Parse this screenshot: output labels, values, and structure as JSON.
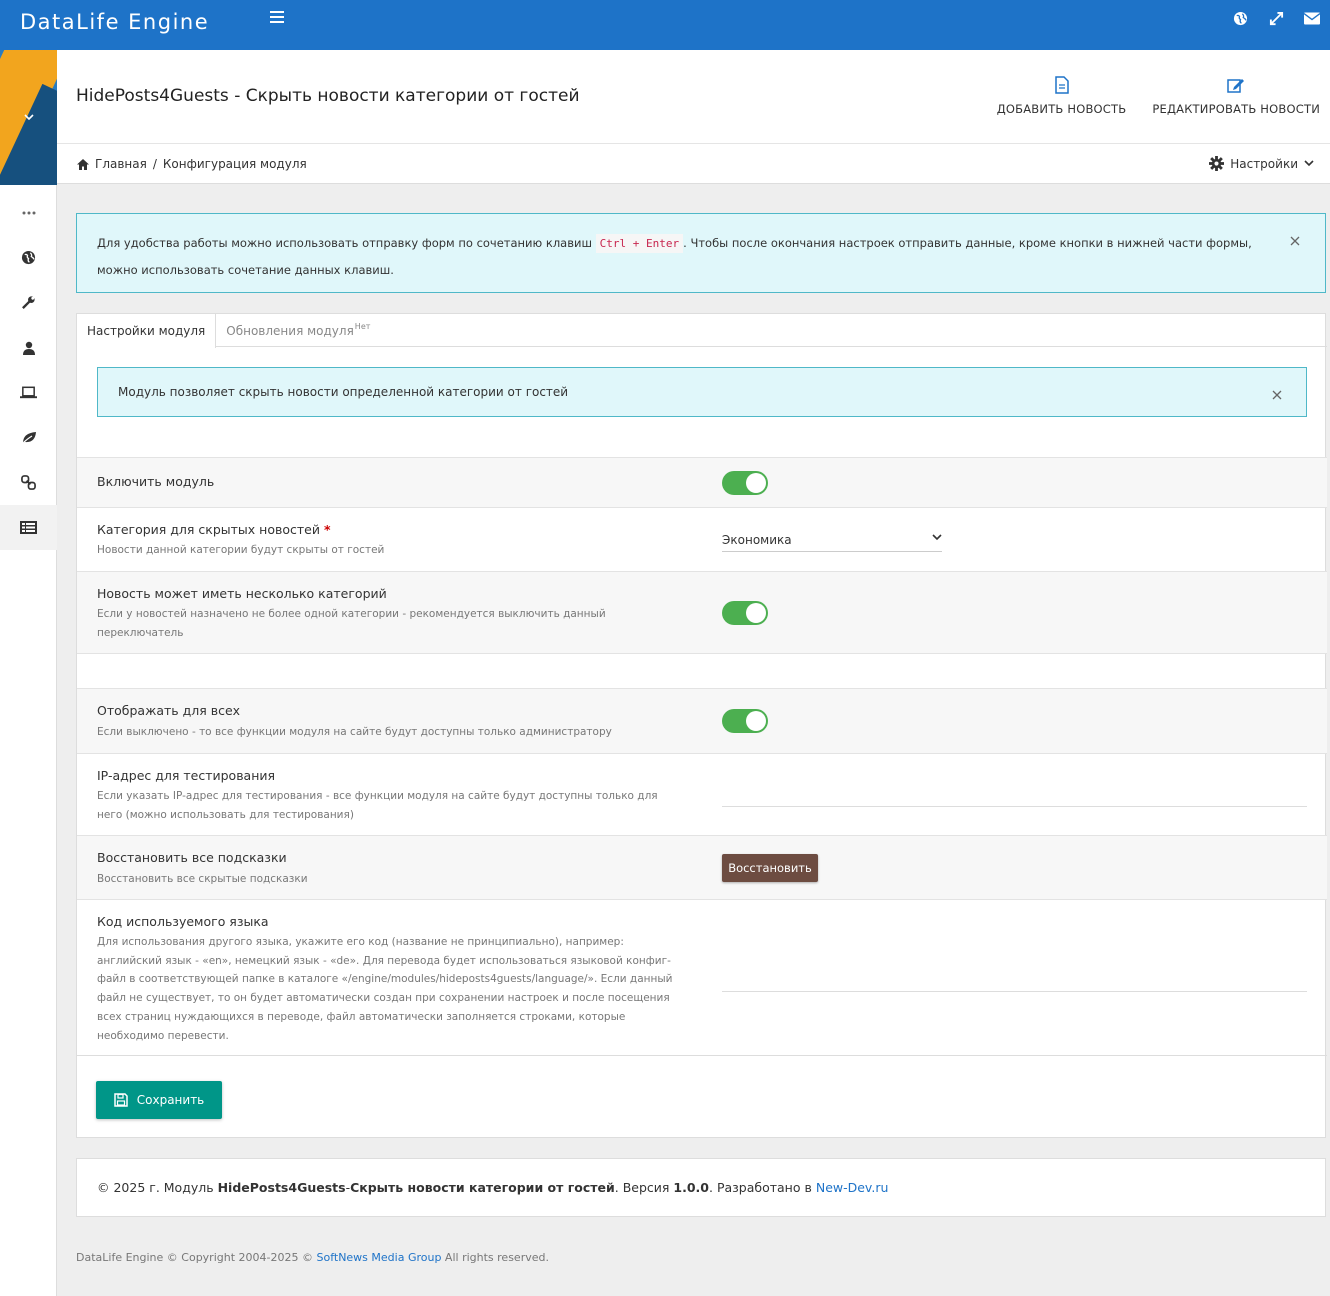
{
  "navbar": {
    "brand": "DataLife Engine",
    "icons": [
      "globe-icon",
      "expand-icon",
      "mail-icon"
    ]
  },
  "sidebar": {
    "items": [
      "dots-icon",
      "globe-icon",
      "wrench-icon",
      "user-icon",
      "laptop-icon",
      "leaf-icon",
      "link-icon",
      "list-icon"
    ],
    "active_item": "list-icon"
  },
  "header": {
    "title": "HidePosts4Guests - Скрыть новости категории от гостей",
    "add_news": "ДОБАВИТЬ НОВОСТЬ",
    "edit_news": "РЕДАКТИРОВАТЬ НОВОСТИ"
  },
  "breadcrumb": {
    "home": "Главная",
    "separator": "/",
    "current": "Конфигурация модуля",
    "settings": "Настройки"
  },
  "info_alert": {
    "text_before": "Для удобства работы можно использовать отправку форм по сочетанию клавиш",
    "shortcut": "Ctrl + Enter",
    "text_after": ". Чтобы после окончания настроек отправить данные, кроме кнопки в нижней части формы,",
    "text_line2": "можно использовать сочетание данных клавиш."
  },
  "tabs": {
    "settings": "Настройки модуля",
    "updates": "Обновления модуля",
    "updates_badge": "Нет"
  },
  "module_alert": "Модуль позволяет скрыть новости определенной категории от гостей",
  "settings": {
    "enable": {
      "label": "Включить модуль",
      "on": true
    },
    "category": {
      "label": "Категория для скрытых новостей",
      "required_mark": "*",
      "desc": "Новости данной категории будут скрыты от гостей",
      "value": "Экономика"
    },
    "multi_cat": {
      "label": "Новость может иметь несколько категорий",
      "desc": "Если у новостей назначено не более одной категории - рекомендуется выключить данный переключатель",
      "on": true
    },
    "show_all": {
      "label": "Отображать для всех",
      "desc": "Если выключено - то все функции модуля на сайте будут доступны только администратору",
      "on": true
    },
    "test_ip": {
      "label": "IP-адрес для тестирования",
      "desc": "Если указать IP-адрес для тестирования - все функции модуля на сайте будут доступны только для него (можно использовать для тестирования)",
      "value": ""
    },
    "restore_hints": {
      "label": "Восстановить все подсказки",
      "desc": "Восстановить все скрытые подсказки",
      "button": "Восстановить"
    },
    "lang_code": {
      "label": "Код используемого языка",
      "desc": "Для использования другого языка, укажите его код (название не принципиально), например: английский язык - «en», немецкий язык - «de». Для перевода будет использоваться языковой конфиг-файл в соответствующей папке в каталоге «/engine/modules/hideposts4guests/language/». Если данный файл не существует, то он будет автоматически создан при сохранении настроек и после посещения всех страниц нуждающихся в переводе, файл автоматически заполняется строками, которые необходимо перевести.",
      "value": ""
    }
  },
  "save_button": "Сохранить",
  "footer": {
    "prefix": "© 2025 г. Модуль ",
    "module_name": "HidePosts4Guests",
    "dash": " - ",
    "module_title": "Скрыть новости категории от гостей",
    "version_label": ". Версия ",
    "version": "1.0.0",
    "dev_label": ". Разработано в ",
    "dev_link": "New-Dev.ru"
  },
  "copyright": {
    "before": "DataLife Engine © Copyright 2004-2025 © ",
    "link": "SoftNews Media Group",
    "after": " All rights reserved."
  },
  "colors": {
    "navbar": "#1e73c8",
    "toggle_on": "#4caf50",
    "save_button": "#009688",
    "restore_button": "#6d4c41",
    "alert_bg": "#e0f7fa"
  }
}
